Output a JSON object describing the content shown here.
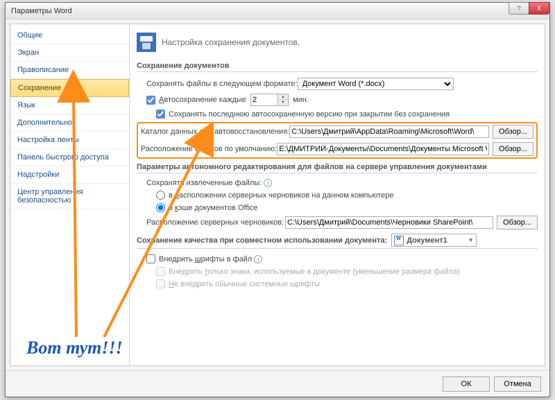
{
  "window": {
    "title": "Параметры Word"
  },
  "titlebar_buttons": {
    "help": "?",
    "close": "X"
  },
  "sidebar": {
    "items": [
      {
        "label": "Общие"
      },
      {
        "label": "Экран"
      },
      {
        "label": "Правописание"
      },
      {
        "label": "Сохранение",
        "selected": true
      },
      {
        "label": "Язык"
      },
      {
        "label": "Дополнительно"
      },
      {
        "label": "Настройка ленты"
      },
      {
        "label": "Панель быстрого доступа"
      },
      {
        "label": "Надстройки"
      },
      {
        "label": "Центр управления безопасностью"
      }
    ]
  },
  "main": {
    "page_title": "Настройка сохранения документов.",
    "section_save_docs": {
      "title": "Сохранение документов",
      "format_label": "Сохранять файлы в следующем формате:",
      "format_value": "Документ Word (*.docx)",
      "autosave_label_pre": "Автосохранение каждые",
      "autosave_value": "2",
      "autosave_label_post": "мин.",
      "keep_last_label": "Сохранять последнюю автосохраненную версию при закрытии без сохранения",
      "recovery_dir_label": "Каталог данных для автовосстановления:",
      "recovery_dir_value": "C:\\Users\\Дмитрий\\AppData\\Roaming\\Microsoft\\Word\\",
      "default_loc_label": "Расположение файлов по умолчанию:",
      "default_loc_value": "E:\\ДМИТРИЙ-Документы\\Documents\\Документы Microsoft Word",
      "browse_label": "Обзор..."
    },
    "section_offline": {
      "title": "Параметры автономного редактирования для файлов на сервере управления документами",
      "save_extracted_label": "Сохранять извлеченные файлы:",
      "opt_server_drafts": "в расположении серверных черновиков на данном компьютере",
      "opt_office_cache": "в кэше документов Office",
      "server_drafts_loc_label": "Расположение серверных черновиков:",
      "server_drafts_loc_value": "C:\\Users\\Дмитрий\\Documents\\Черновики SharePoint\\",
      "browse_label": "Обзор..."
    },
    "section_quality": {
      "title": "Сохранение качества при совместном использовании документа:",
      "doc_value": "Документ1",
      "embed_fonts": "Внедрить шрифты в файл",
      "embed_only_used": "Внедрять только знаки, используемые в документе (уменьшение размера файла)",
      "no_system_fonts": "Не внедрять обычные системные шрифты"
    }
  },
  "footer": {
    "ok": "ОК",
    "cancel": "Отмена"
  },
  "annotation": {
    "text": "Вот тут!!!"
  }
}
